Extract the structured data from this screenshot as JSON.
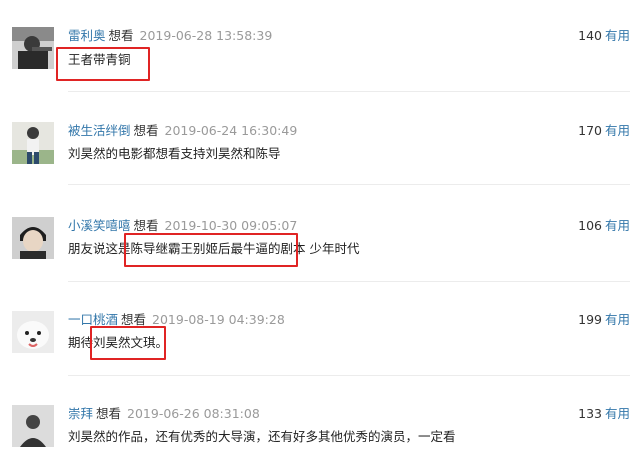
{
  "comments": [
    {
      "user": "雷利奥",
      "status": "想看",
      "time": "2019-06-28 13:58:39",
      "votes": "140",
      "useful_label": "有用",
      "text": "王者带青铜",
      "avatar_icon": "user-avatar-icon"
    },
    {
      "user": "被生活绊倒",
      "status": "想看",
      "time": "2019-06-24 16:30:49",
      "votes": "170",
      "useful_label": "有用",
      "text": "刘昊然的电影都想看支持刘昊然和陈导",
      "avatar_icon": "user-avatar-icon"
    },
    {
      "user": "小溪笑嘻嘻",
      "status": "想看",
      "time": "2019-10-30 09:05:07",
      "votes": "106",
      "useful_label": "有用",
      "text": "朋友说这是陈导继霸王别姬后最牛逼的剧本   少年时代",
      "avatar_icon": "user-avatar-icon"
    },
    {
      "user": "一口桃酒",
      "status": "想看",
      "time": "2019-08-19 04:39:28",
      "votes": "199",
      "useful_label": "有用",
      "text": "期待刘昊然文琪。",
      "avatar_icon": "user-avatar-icon"
    },
    {
      "user": "崇拜",
      "status": "想看",
      "time": "2019-06-26 08:31:08",
      "votes": "133",
      "useful_label": "有用",
      "text": "刘昊然的作品，还有优秀的大导演，还有好多其他优秀的演员，一定看",
      "avatar_icon": "user-avatar-icon"
    }
  ],
  "colors": {
    "link": "#3377aa",
    "highlight": "#e02424",
    "time": "#9a9a9a"
  }
}
